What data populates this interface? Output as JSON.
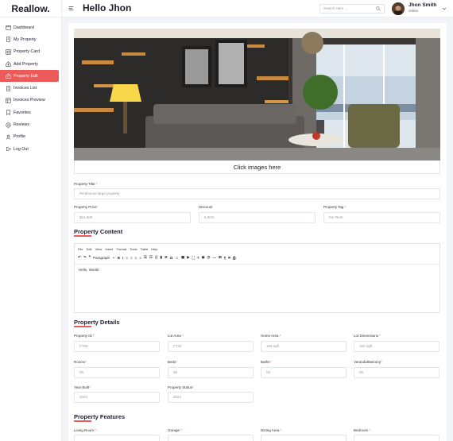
{
  "app": {
    "logo": "Reallow."
  },
  "sidebar": {
    "items": [
      {
        "label": "Dashboard",
        "icon": "calendar-icon",
        "active": false
      },
      {
        "label": "My Property",
        "icon": "building-icon",
        "active": false
      },
      {
        "label": "Property Card",
        "icon": "card-icon",
        "active": false
      },
      {
        "label": "Add Property",
        "icon": "add-home-icon",
        "active": false
      },
      {
        "label": "Property Edit",
        "icon": "edit-home-icon",
        "active": true
      },
      {
        "label": "Invoices List",
        "icon": "document-icon",
        "active": false
      },
      {
        "label": "Invoices Preview",
        "icon": "invoice-icon",
        "active": false
      },
      {
        "label": "Favorites",
        "icon": "bookmark-icon",
        "active": false
      },
      {
        "label": "Reviews",
        "icon": "star-icon",
        "active": false
      },
      {
        "label": "Profile",
        "icon": "user-icon",
        "active": false
      },
      {
        "label": "Log Out",
        "icon": "logout-icon",
        "active": false
      }
    ]
  },
  "header": {
    "title": "Hello Jhon",
    "search_placeholder": "Search Here ...",
    "user_name": "Jhon Smith",
    "user_status": "online"
  },
  "main": {
    "upload_text": "Click images here",
    "property_title": {
      "label": "Property Title",
      "value": "Penthouse large property"
    },
    "property_price": {
      "label": "Property Price",
      "value": "$14,000"
    },
    "discount": {
      "label": "Discount",
      "value": "5.00%"
    },
    "property_tag": {
      "label": "Property Tag",
      "value": "For Rent"
    },
    "content_section": "Property Content",
    "editor": {
      "menu": [
        "File",
        "Edit",
        "View",
        "Insert",
        "Format",
        "Tools",
        "Table",
        "Help"
      ],
      "format_select": "Paragraph",
      "body": "Hello, World!"
    },
    "details_section": "Property Details",
    "details": [
      {
        "label": "Property ID",
        "value": "FT30"
      },
      {
        "label": "Lot Area",
        "value": "FT30"
      },
      {
        "label": "Home Area",
        "value": "150 sqft"
      },
      {
        "label": "Lot Dimensions",
        "value": "150 sqft"
      },
      {
        "label": "Rooms",
        "value": "06"
      },
      {
        "label": "Beds",
        "value": "06"
      },
      {
        "label": "Baths",
        "value": "03"
      },
      {
        "label": "Veranda/Balcony",
        "value": "05"
      },
      {
        "label": "Year Built",
        "value": "2024"
      },
      {
        "label": "Property Status",
        "value": "2024"
      }
    ],
    "features_section": "Property Features",
    "features": [
      {
        "label": "Living Room"
      },
      {
        "label": "Garage"
      },
      {
        "label": "Dining Area"
      },
      {
        "label": "Bedroom"
      }
    ]
  },
  "colors": {
    "accent": "#ec5a5a",
    "text": "#1d1d2c",
    "background": "#f3f4f8"
  }
}
